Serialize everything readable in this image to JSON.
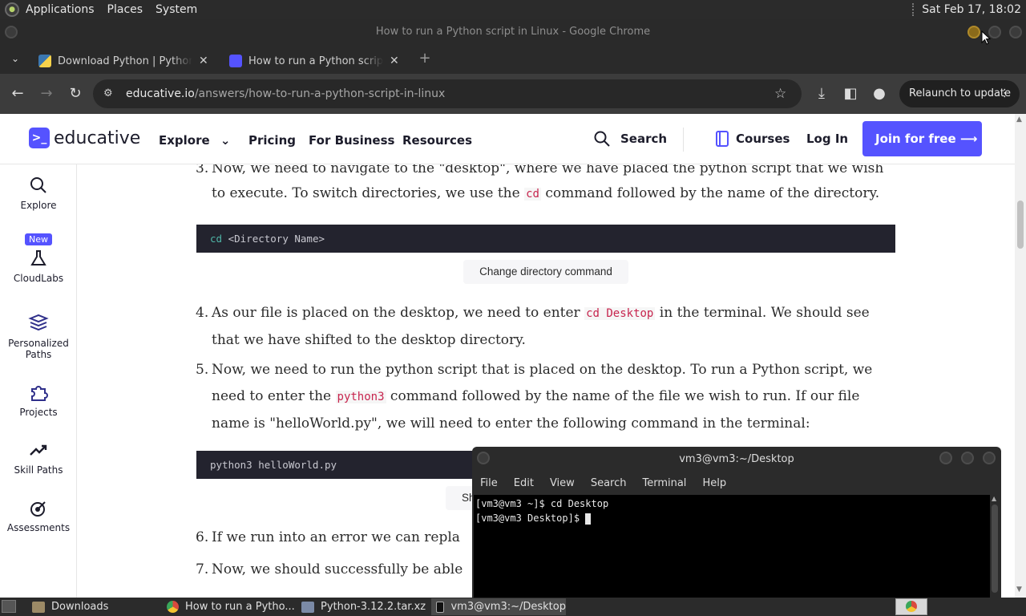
{
  "top_panel": {
    "menus": [
      "Applications",
      "Places",
      "System"
    ],
    "clock": "Sat Feb 17, 18:02"
  },
  "chrome": {
    "window_title": "How to run a Python script in Linux - Google Chrome",
    "tabs": [
      {
        "title": "Download Python | Python.org"
      },
      {
        "title": "How to run a Python script in Linux"
      }
    ],
    "url_host": "educative.io",
    "url_path": "/answers/how-to-run-a-python-script-in-linux",
    "relaunch_label": "Relaunch to update"
  },
  "site": {
    "brand": "educative",
    "nav": {
      "explore": "Explore",
      "pricing": "Pricing",
      "business": "For Business",
      "resources": "Resources"
    },
    "search": "Search",
    "courses": "Courses",
    "login": "Log In",
    "join": "Join for free ⟶"
  },
  "rail": {
    "explore": "Explore",
    "new_badge": "New",
    "cloudlabs": "CloudLabs",
    "personalized_1": "Personalized",
    "personalized_2": "Paths",
    "projects": "Projects",
    "skill_paths": "Skill Paths",
    "assessments": "Assessments"
  },
  "article": {
    "step3": {
      "num": "3.",
      "a": "Now, we need to navigate to the \"desktop\", where we have placed the python script that we wish to execute. To switch directories, we use the ",
      "code": "cd",
      "b": " command followed by the name of the directory."
    },
    "code1_kw": "cd",
    "code1_rest": " <Directory Name>",
    "caption1": "Change directory command",
    "step4": {
      "num": "4.",
      "a": "As our file is placed on the desktop, we need to enter ",
      "code": "cd Desktop",
      "b": " in the terminal. We should see that we have shifted to the desktop directory."
    },
    "step5": {
      "num": "5.",
      "a": " Now, we need to run the python script that is placed on the desktop. To run a Python script, we need to enter the ",
      "code": "python3",
      "b": " command followed by the name of the file we wish to run. If our file name is \"helloWorld.py\", we will need to enter the following command in the terminal:"
    },
    "code2": "python3 helloWorld.py",
    "caption2_partial": "Sh",
    "step6": {
      "num": "6.",
      "a": "If we run into an error we can repla"
    },
    "step7": {
      "num": "7.",
      "a": "Now, we should successfully be able"
    }
  },
  "terminal": {
    "title": "vm3@vm3:~/Desktop",
    "menu": [
      "File",
      "Edit",
      "View",
      "Search",
      "Terminal",
      "Help"
    ],
    "line1": "[vm3@vm3 ~]$ cd Desktop",
    "line2": "[vm3@vm3 Desktop]$ "
  },
  "taskbar": {
    "items": [
      "Downloads",
      "How to run a Pytho...",
      "Python-3.12.2.tar.xz",
      "vm3@vm3:~/Desktop"
    ]
  },
  "colors": {
    "brand": "#5553ff",
    "code_bg": "#23232e",
    "inline_code": "#c7254e"
  }
}
